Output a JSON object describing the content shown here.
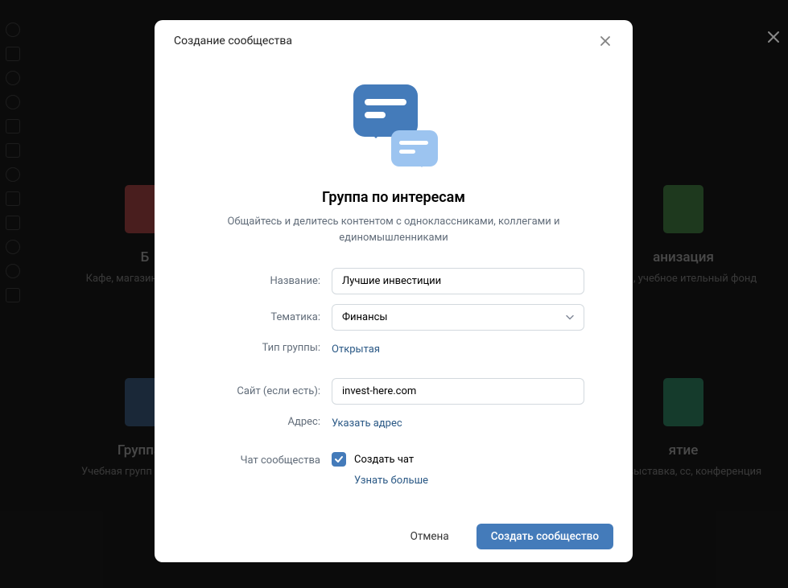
{
  "bg": {
    "row1": [
      {
        "title": "Б",
        "desc": "Кафе, магазин\nкинотеат",
        "color": "red"
      },
      {
        "title": "анизация",
        "desc": "ания, учебное\nительный фонд",
        "color": "green"
      }
    ],
    "row2": [
      {
        "title": "Группа п",
        "desc": "Учебная групп\nобъединен",
        "color": "blue"
      },
      {
        "title": "ятие",
        "desc": "ния, выставка,\nсс, конференция",
        "color": "teal"
      }
    ]
  },
  "modal": {
    "title": "Создание сообщества",
    "hero_title": "Группа по интересам",
    "hero_desc": "Общайтесь и делитесь контентом с одноклассниками, коллегами и единомышленниками",
    "form": {
      "name_label": "Название:",
      "name_value": "Лучшие инвестиции",
      "topic_label": "Тематика:",
      "topic_value": "Финансы",
      "type_label": "Тип группы:",
      "type_value": "Открытая",
      "site_label": "Сайт (если есть):",
      "site_value": "invest-here.com",
      "address_label": "Адрес:",
      "address_value": "Указать адрес",
      "chat_label": "Чат сообщества",
      "chat_checkbox_label": "Создать чат",
      "learn_more": "Узнать больше"
    },
    "footer": {
      "cancel": "Отмена",
      "submit": "Создать сообщество"
    }
  }
}
